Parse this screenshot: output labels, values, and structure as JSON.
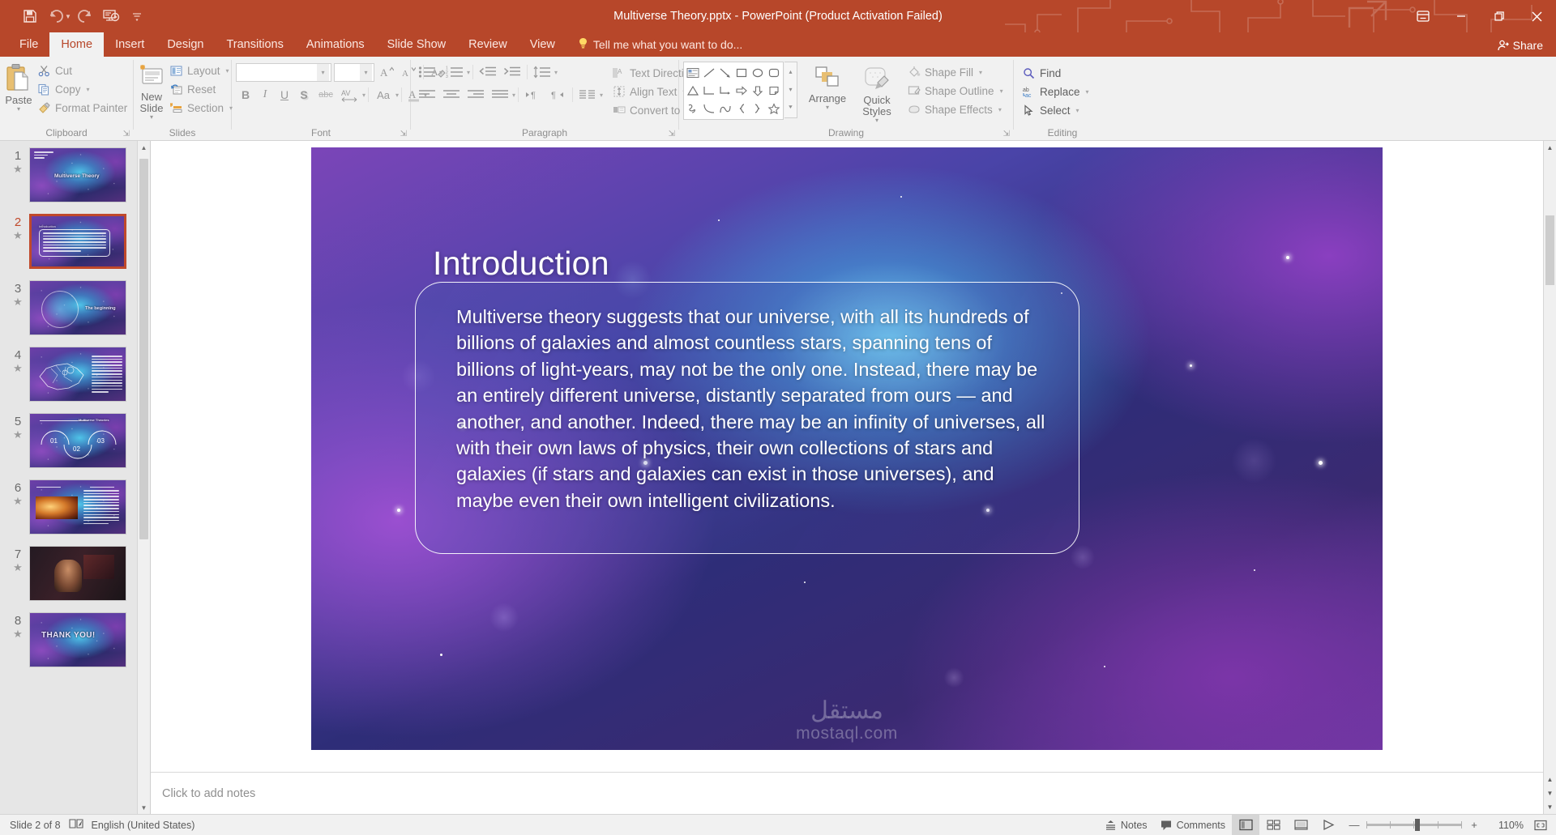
{
  "window": {
    "title": "Multiverse Theory.pptx - PowerPoint (Product Activation Failed)",
    "accent_color": "#b7472a",
    "quick_access": [
      {
        "name": "save",
        "label": "Save"
      },
      {
        "name": "undo",
        "label": "Undo"
      },
      {
        "name": "redo",
        "label": "Repeat"
      },
      {
        "name": "start-slideshow",
        "label": "Start From Beginning"
      },
      {
        "name": "customize-qat",
        "label": "Customize Quick Access Toolbar"
      }
    ],
    "controls": [
      {
        "name": "ribbon-display-options",
        "label": "Ribbon Display Options"
      },
      {
        "name": "minimize",
        "label": "Minimize"
      },
      {
        "name": "restore",
        "label": "Restore Down"
      },
      {
        "name": "close",
        "label": "Close"
      }
    ]
  },
  "tabs": [
    {
      "label": "File",
      "active": false
    },
    {
      "label": "Home",
      "active": true
    },
    {
      "label": "Insert",
      "active": false
    },
    {
      "label": "Design",
      "active": false
    },
    {
      "label": "Transitions",
      "active": false
    },
    {
      "label": "Animations",
      "active": false
    },
    {
      "label": "Slide Show",
      "active": false
    },
    {
      "label": "Review",
      "active": false
    },
    {
      "label": "View",
      "active": false
    }
  ],
  "tell_me": "Tell me what you want to do...",
  "share": "Share",
  "ribbon": {
    "clipboard": {
      "label": "Clipboard",
      "paste": "Paste",
      "items": [
        {
          "label": "Cut",
          "icon": "scissors-icon"
        },
        {
          "label": "Copy",
          "icon": "copy-icon"
        },
        {
          "label": "Format Painter",
          "icon": "format-painter-icon"
        }
      ]
    },
    "slides": {
      "label": "Slides",
      "new_slide": "New Slide",
      "items": [
        {
          "label": "Layout",
          "icon": "layout-icon"
        },
        {
          "label": "Reset",
          "icon": "reset-icon"
        },
        {
          "label": "Section",
          "icon": "section-icon"
        }
      ]
    },
    "font": {
      "label": "Font",
      "font_name": "",
      "font_name_placeholder": "",
      "font_size": "",
      "font_size_placeholder": "",
      "buttons": [
        "increase-font-size",
        "decrease-font-size",
        "clear-formatting",
        "bold",
        "italic",
        "underline",
        "text-shadow",
        "strikethrough",
        "character-spacing",
        "change-case",
        "font-color"
      ]
    },
    "paragraph": {
      "label": "Paragraph",
      "items": [
        {
          "label": "Text Direction",
          "icon": "text-direction-icon"
        },
        {
          "label": "Align Text",
          "icon": "align-text-icon"
        },
        {
          "label": "Convert to SmartArt",
          "icon": "smartart-icon"
        }
      ]
    },
    "drawing": {
      "label": "Drawing",
      "arrange": "Arrange",
      "quick_styles": "Quick Styles",
      "items": [
        {
          "label": "Shape Fill",
          "icon": "shape-fill-icon"
        },
        {
          "label": "Shape Outline",
          "icon": "shape-outline-icon"
        },
        {
          "label": "Shape Effects",
          "icon": "shape-effects-icon"
        }
      ]
    },
    "editing": {
      "label": "Editing",
      "items": [
        {
          "label": "Find",
          "icon": "search-icon"
        },
        {
          "label": "Replace",
          "icon": "replace-icon"
        },
        {
          "label": "Select",
          "icon": "select-arrow-icon"
        }
      ]
    }
  },
  "thumbnails": [
    {
      "number": "1",
      "title": "Multiverse Theory",
      "layout": "title"
    },
    {
      "number": "2",
      "title": "Introduction",
      "layout": "text-box",
      "selected": true
    },
    {
      "number": "3",
      "title": "The beginning",
      "layout": "title-right"
    },
    {
      "number": "4",
      "title": "",
      "layout": "map-text"
    },
    {
      "number": "5",
      "title": "Multiverse Theories",
      "layout": "circles"
    },
    {
      "number": "6",
      "title": "",
      "layout": "image-text"
    },
    {
      "number": "7",
      "title": "",
      "layout": "photo"
    },
    {
      "number": "8",
      "title": "THANK YOU!",
      "layout": "thanks"
    }
  ],
  "slide": {
    "title": "Introduction",
    "body": "Multiverse theory suggests that our universe, with all its hundreds of billions of galaxies and almost countless stars, spanning tens of billions of light-years, may not be the only one. Instead, there may be an entirely different universe, distantly separated from ours — and another, and another. Indeed, there may be an infinity of universes, all with their own laws of physics, their own collections of stars and galaxies (if stars and galaxies can exist in those universes), and maybe even their own intelligent civilizations.",
    "watermark_ar": "مستقل",
    "watermark_en": "mostaql.com"
  },
  "notes": {
    "placeholder": "Click to add notes"
  },
  "status": {
    "slide_counter": "Slide 2 of 8",
    "language": "English (United States)",
    "notes_label": "Notes",
    "comments_label": "Comments",
    "zoom_level": "110%",
    "views": [
      {
        "name": "normal-view",
        "active": true
      },
      {
        "name": "slide-sorter-view",
        "active": false
      },
      {
        "name": "reading-view",
        "active": false
      },
      {
        "name": "slide-show-view",
        "active": false
      }
    ]
  }
}
